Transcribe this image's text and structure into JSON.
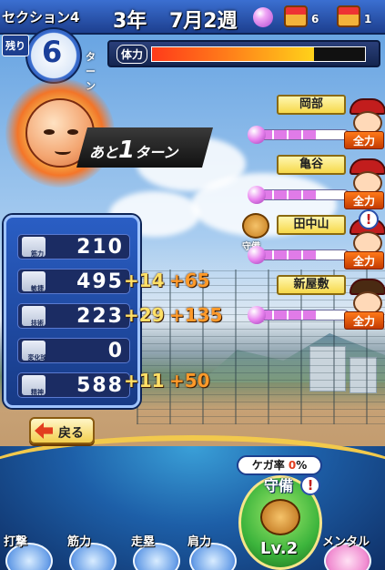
{
  "header": {
    "section_label": "セクション4",
    "year": "3年",
    "week": "7月2週",
    "treasure_1_count": "6",
    "treasure_2_count": "1"
  },
  "turns": {
    "remaining_label": "残り",
    "remaining_value": "6",
    "unit": "ターン",
    "banner_prefix": "あと",
    "banner_value": "1",
    "banner_suffix": "ターン"
  },
  "stamina": {
    "label": "体力",
    "level_percent": 76
  },
  "players": [
    {
      "name": "岡部",
      "badge": "全力",
      "gauge_percent": 64
    },
    {
      "name": "亀谷",
      "badge": "全力",
      "gauge_percent": 64
    },
    {
      "name": "田中山",
      "badge": "全力",
      "gauge_percent": 64,
      "glove_label": "守備",
      "alert": "!"
    },
    {
      "name": "新屋敷",
      "badge": "全力",
      "gauge_percent": 64
    }
  ],
  "stats": [
    {
      "label": "筋力",
      "value": "210",
      "bonus1": "",
      "bonus2": ""
    },
    {
      "label": "敏捷",
      "value": "495",
      "bonus1": "+14",
      "bonus2": "+65"
    },
    {
      "label": "技術",
      "value": "223",
      "bonus1": "+29",
      "bonus2": "+135"
    },
    {
      "label": "変化球",
      "value": "0",
      "bonus1": "",
      "bonus2": ""
    },
    {
      "label": "精神",
      "value": "588",
      "bonus1": "+11",
      "bonus2": "+50"
    }
  ],
  "back_button": {
    "label": "戻る"
  },
  "injury": {
    "label": "ケガ率",
    "value": "0",
    "unit": "%"
  },
  "defence": {
    "label": "守備",
    "level": "Lv.2",
    "alert": "!"
  },
  "tabs": [
    "打撃",
    "筋力",
    "走塁",
    "肩力",
    "メンタル"
  ],
  "colors": {
    "accent_blue": "#1d3f8f",
    "gold": "#f3cf4e",
    "badge_orange": "#ff7a1a",
    "gauge_pink": "#e07be8"
  }
}
